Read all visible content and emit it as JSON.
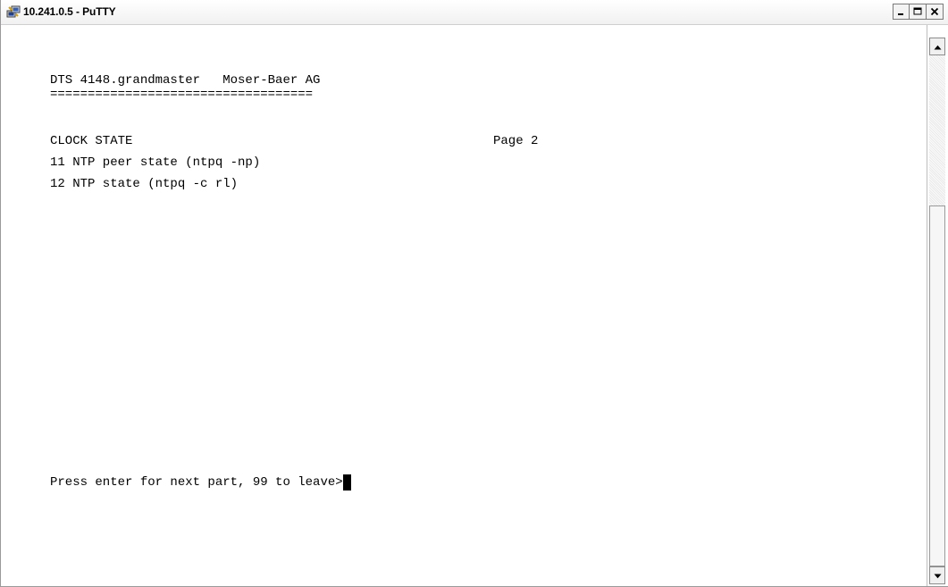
{
  "window": {
    "title": "10.241.0.5 - PuTTY",
    "icon": "putty-app-icon",
    "controls": {
      "minimize_icon": "minimize-icon",
      "maximize_icon": "maximize-icon",
      "close_icon": "close-icon"
    }
  },
  "terminal": {
    "header": "DTS 4148.grandmaster   Moser-Baer AG",
    "separator": "===================================",
    "section_title": "CLOCK STATE",
    "page_label": "Page 2",
    "menu_items": [
      "11 NTP peer state (ntpq -np)",
      "12 NTP state (ntpq -c rl)"
    ],
    "prompt": "Press enter for next part, 99 to leave>"
  },
  "scrollbar": {
    "up_icon": "scroll-up-arrow-icon",
    "down_icon": "scroll-down-arrow-icon"
  },
  "colors": {
    "terminal_background": "#ffffff",
    "terminal_text": "#000000",
    "cursor": "#000000"
  }
}
